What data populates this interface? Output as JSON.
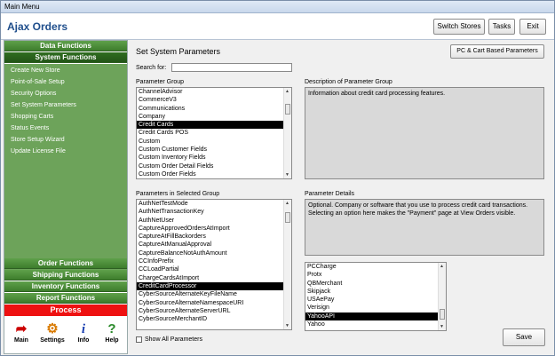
{
  "window": {
    "title": "Main Menu"
  },
  "header": {
    "app_title": "Ajax Orders",
    "switch_stores": "Switch Stores",
    "tasks": "Tasks",
    "exit": "Exit"
  },
  "sidebar": {
    "groups_top": [
      "Data Functions",
      "System Functions"
    ],
    "items": [
      "Create New Store",
      "Point-of-Sale Setup",
      "Security Options",
      "Set System Parameters",
      "Shopping Carts",
      "Status Events",
      "Store Setup Wizard",
      "Update License File"
    ],
    "groups_bottom": [
      "Order Functions",
      "Shipping Functions",
      "Inventory Functions",
      "Report Functions"
    ],
    "process": "Process",
    "nav": [
      {
        "label": "Main",
        "icon": "arrow-icon"
      },
      {
        "label": "Settings",
        "icon": "gear-icon"
      },
      {
        "label": "Info",
        "icon": "info-icon"
      },
      {
        "label": "Help",
        "icon": "help-icon"
      }
    ]
  },
  "main": {
    "title": "Set System Parameters",
    "pc_cart_button": "PC & Cart Based Parameters",
    "search_label": "Search for:",
    "search_value": "",
    "param_group_label": "Parameter Group",
    "param_groups": [
      "ChannelAdvisor",
      "CommerceV3",
      "Communications",
      "Company",
      "Credit Cards",
      "Credit Cards POS",
      "Custom",
      "Custom Customer Fields",
      "Custom Inventory Fields",
      "Custom Order Detail Fields",
      "Custom Order Fields"
    ],
    "param_group_selected": 4,
    "desc_label": "Description of Parameter Group",
    "desc_text": "Information about credit card processing features.",
    "params_label": "Parameters in Selected Group",
    "params": [
      "AuthNetTestMode",
      "AuthNetTransactionKey",
      "AuthNetUser",
      "CaptureApprovedOrdersAtImport",
      "CaptureAtFillBackorders",
      "CaptureAtManualApproval",
      "CaptureBalanceNotAuthAmount",
      "CCInfoPrefix",
      "CCLoadPartial",
      "ChargeCardsAtImport",
      "CreditCardProcessor",
      "CyberSourceAlternateKeyFileName",
      "CyberSourceAlternateNamespaceURI",
      "CyberSourceAlternateServerURL",
      "CyberSourceMerchantID"
    ],
    "params_selected": 10,
    "details_label": "Parameter Details",
    "details_text": "Optional. Company or software that you use to process credit card transactions. Selecting an option here makes the \"Payment\" page at View Orders visible.",
    "options": [
      "PCCharge",
      "Protx",
      "QBMerchant",
      "Skipjack",
      "USAePay",
      "Verisign",
      "YahooAPI",
      "Yahoo"
    ],
    "options_selected": 6,
    "show_all_label": "Show All Parameters",
    "save_label": "Save"
  }
}
